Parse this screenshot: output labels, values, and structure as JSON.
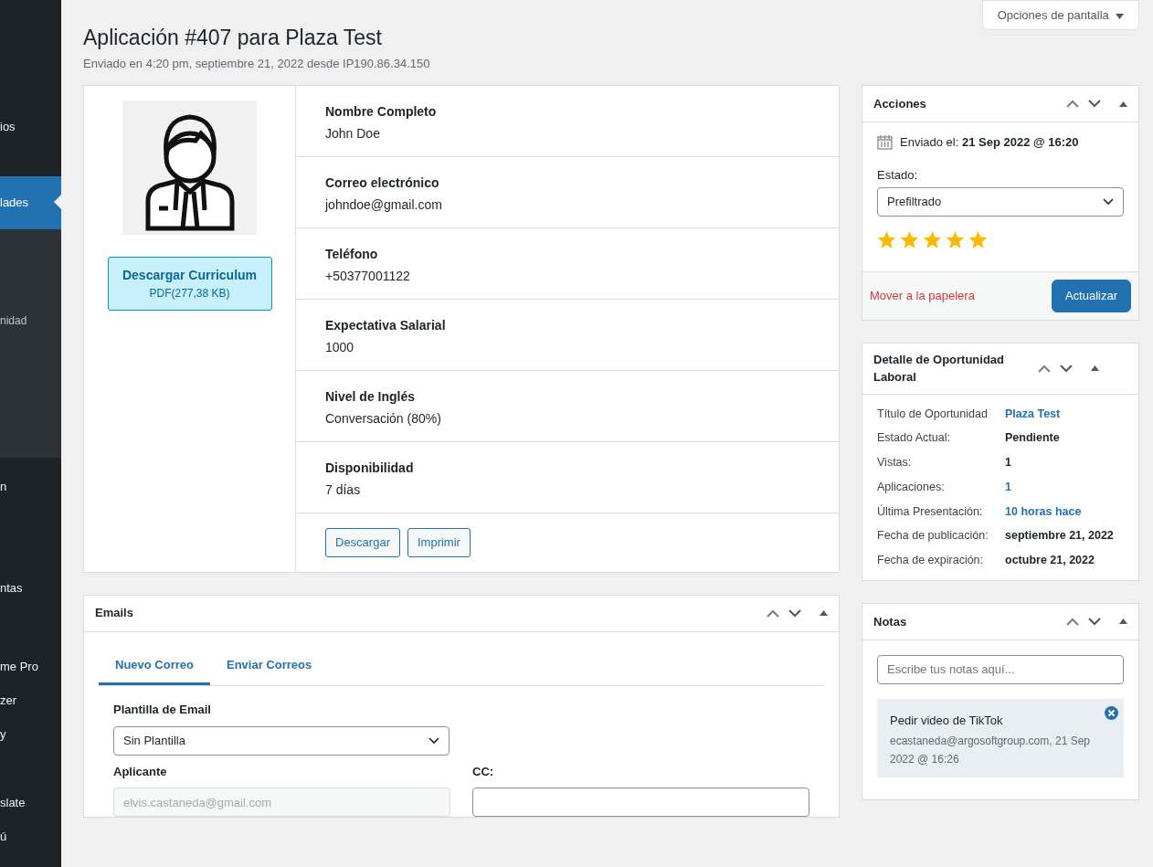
{
  "sidebar": {
    "items": [
      {
        "label": "ios",
        "selected": false
      },
      {
        "label": "lades",
        "selected": true,
        "children": [
          {
            "label": "nidad"
          }
        ]
      },
      {
        "label": "n",
        "selected": false
      },
      {
        "label": "ntas",
        "selected": false
      },
      {
        "label": "me Pro",
        "selected": false
      },
      {
        "label": "zer",
        "selected": false
      },
      {
        "label": "y",
        "selected": false
      },
      {
        "label": "slate",
        "selected": false
      },
      {
        "label": "ú",
        "selected": false
      }
    ]
  },
  "screen_options": {
    "label": "Opciones de pantalla"
  },
  "page": {
    "title": "Aplicación #407 para Plaza Test",
    "subtitle": "Enviado en 4:20 pm, septiembre 21, 2022 desde IP190.86.34.150"
  },
  "applicant": {
    "resume_button": {
      "label": "Descargar Curriculum",
      "sublabel": "PDF(277,38 KB)"
    },
    "fields": [
      {
        "label": "Nombre Completo",
        "value": "John Doe"
      },
      {
        "label": "Correo electrónico",
        "value": "johndoe@gmail.com"
      },
      {
        "label": "Teléfono",
        "value": "+50377001122"
      },
      {
        "label": "Expectativa Salarial",
        "value": "1000"
      },
      {
        "label": "Nivel de Inglés",
        "value": "Conversación (80%)"
      },
      {
        "label": "Disponibilidad",
        "value": "7 días"
      }
    ],
    "buttons": [
      "Descargar",
      "Imprimir"
    ]
  },
  "emails": {
    "title": "Emails",
    "tabs": [
      {
        "label": "Nuevo Correo",
        "selected": true
      },
      {
        "label": "Enviar Correos",
        "selected": false
      }
    ],
    "template": {
      "label": "Plantilla de Email",
      "value": "Sin Plantilla"
    },
    "applicant": {
      "label": "Aplicante",
      "placeholder": "elvis.castaneda@gmail.com"
    },
    "cc": {
      "label": "CC:"
    }
  },
  "actions": {
    "title": "Acciones",
    "sent_label": "Enviado el:",
    "sent_value": "21 Sep 2022 @ 16:20",
    "status_label": "Estado:",
    "status_value": "Prefiltrado",
    "stars": 5,
    "trash_link": "Mover a la papelera",
    "update_button": "Actualizar"
  },
  "opportunity": {
    "title": "Detalle de Oportunidad Laboral",
    "rows": [
      {
        "label": "Título de Oportunidad",
        "value": "Plaza Test",
        "kind": "link"
      },
      {
        "label": "Estado Actual:",
        "value": "Pendiente",
        "kind": "text"
      },
      {
        "label": "Vistas:",
        "value": "1",
        "kind": "text"
      },
      {
        "label": "Aplicaciones:",
        "value": "1",
        "kind": "link"
      },
      {
        "label": "Última Presentación:",
        "value": "10 horas hace",
        "kind": "link"
      },
      {
        "label": "Fecha de publicación:",
        "value": "septiembre 21, 2022",
        "kind": "text"
      },
      {
        "label": "Fecha de expiración:",
        "value": "octubre 21, 2022",
        "kind": "text"
      }
    ]
  },
  "notes": {
    "title": "Notas",
    "placeholder": "Escribe tus notas aquí...",
    "items": [
      {
        "text": "Pedir video de TikTok",
        "meta": "ecastaneda@argosoftgroup.com, 21 Sep 2022 @ 16:26"
      }
    ]
  }
}
